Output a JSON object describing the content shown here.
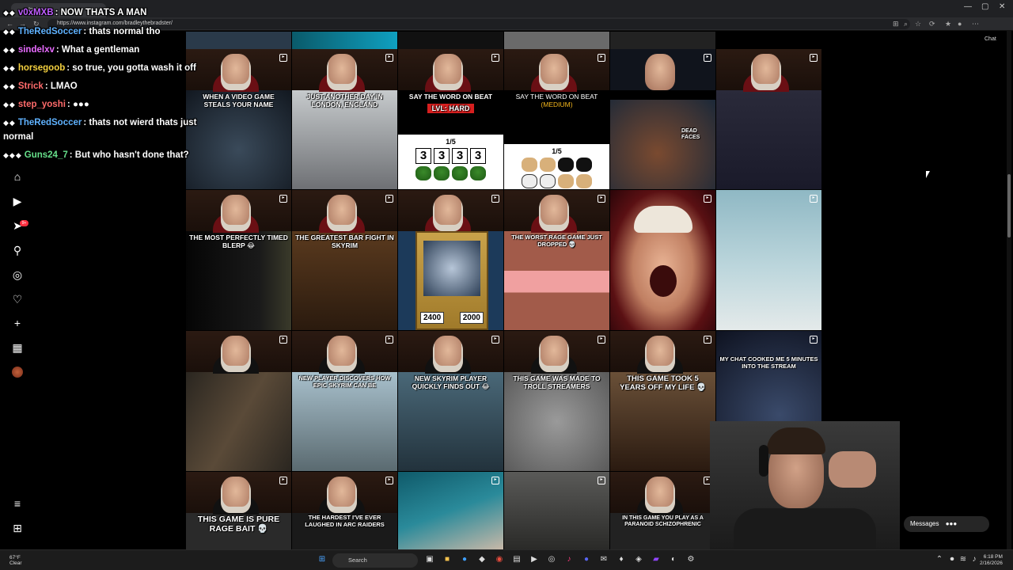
{
  "browser": {
    "tab_title": "Instagram",
    "url": "https://www.instagram.com/bradleythebradster/",
    "chat_button": "Chat"
  },
  "chat": {
    "messages": [
      {
        "user": "v0xMXB",
        "text": "NOW THATS A MAN",
        "color": "#bf5dff"
      },
      {
        "user": "TheRedSoccer",
        "text": "thats normal tho",
        "color": "#5fb2ff"
      },
      {
        "user": "sindelxv",
        "text": "What a gentleman",
        "color": "#e86bff"
      },
      {
        "user": "horsegoob",
        "text": "so true, you gotta wash it off",
        "color": "#f4d03f"
      },
      {
        "user": "Strick",
        "text": "LMAO",
        "color": "#ff6b6b"
      },
      {
        "user": "step_yoshi",
        "text": "",
        "color": "#ff6b6b"
      },
      {
        "user": "TheRedSoccer",
        "text": "thats not wierd thats just",
        "color": "#5fb2ff"
      },
      {
        "user": "",
        "text": "normal",
        "color": "#ffffff"
      },
      {
        "user": "Guns24_7",
        "text": "But who hasn't done that?",
        "color": "#66e08a"
      }
    ]
  },
  "sidebar": {
    "icons": [
      "home-icon",
      "reels-icon",
      "messages-icon",
      "search-icon",
      "explore-icon",
      "notifications-icon",
      "create-icon",
      "dashboard-icon",
      "profile-icon"
    ],
    "badge": "9+",
    "bottom_icons": [
      "menu-icon",
      "also-from-meta-icon"
    ]
  },
  "grid": {
    "rows": [
      [
        {
          "caption": "WHEN A VIDEO GAME STEALS YOUR NAME",
          "bg": "#1d2630"
        },
        {
          "caption": "JUST ANOTHER DAY IN LONDON, ENGLAND",
          "bg": "#8a8f94"
        },
        {
          "caption": "say the word on beat",
          "level": "lvl: Hard",
          "quiz_count": "1/5",
          "quiz_nums": [
            "3",
            "3",
            "3",
            "3"
          ],
          "bg": "#000"
        },
        {
          "caption": "SAY THE WORD ON BEAT",
          "medium": "(MEDIUM)",
          "quiz_count": "1/5",
          "bg": "#000"
        },
        {
          "caption": "DEAD FACES",
          "bg": "#1b2838"
        },
        {
          "caption": "",
          "bg": "#1a1a2a"
        }
      ],
      [
        {
          "caption": "THE MOST PERFECTLY TIMED BLERP 😂",
          "bg": "#0b0b0b"
        },
        {
          "caption": "THE GREATEST BAR FIGHT IN SKYRIM",
          "bg": "#3a2616"
        },
        {
          "caption": "",
          "atk": "2400",
          "def": "2000",
          "bg": "#1c3a5a"
        },
        {
          "caption": "THE WORST RAGE GAME JUST DROPPED 💀",
          "bg": "#a25b4a"
        },
        {
          "caption": "",
          "bg": "#000"
        },
        {
          "caption": "",
          "bg": "#4a5a66"
        }
      ],
      [
        {
          "caption": "",
          "bg": "#3b3228"
        },
        {
          "caption": "NEW PLAYER DISCOVERS HOW EPIC SKYRIM CAN BE",
          "bg": "#6c7f8a"
        },
        {
          "caption": "NEW SKYRIM PLAYER QUICKLY FINDS OUT 😂",
          "bg": "#2f4553"
        },
        {
          "caption": "THIS GAME WAS MADE TO TROLL STREAMERS",
          "bg": "#7a7a7a"
        },
        {
          "caption": "THIS GAME TOOK 5 YEARS OFF MY LIFE 💀",
          "bg": "#3a2a1e"
        },
        {
          "caption": "MY CHAT COOKED ME 5 MINUTES INTO THE STREAM",
          "bg": "#2a3040"
        }
      ],
      [
        {
          "caption": "THIS GAME IS PURE RAGE BAIT 💀",
          "bg": "#2a2a2a"
        },
        {
          "caption": "THE HARDEST I'VE EVER LAUGHED IN ARC RAIDERS",
          "bg": "#1a1a1a"
        },
        {
          "caption": "",
          "bg": "#1a4a5a"
        },
        {
          "caption": "",
          "bg": "#4a4a48"
        },
        {
          "caption": "IN THIS GAME YOU PLAY AS A PARANOID SCHIZOPHRENIC",
          "bg": "#222"
        },
        {
          "caption": "",
          "bg": "#111"
        }
      ]
    ]
  },
  "messages_pill": "Messages",
  "taskbar": {
    "temp": "67°F",
    "condition": "Clear",
    "search_label": "Search",
    "time": "6:18 PM",
    "date": "2/16/2026"
  }
}
